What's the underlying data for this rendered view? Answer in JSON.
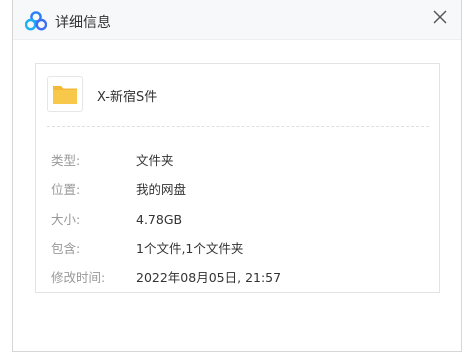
{
  "window": {
    "title": "详细信息"
  },
  "file": {
    "name": "X-新宿S件",
    "icon": "folder-icon",
    "icon_color": "#f7c84a"
  },
  "details": [
    {
      "label": "类型:",
      "value": "文件夹"
    },
    {
      "label": "位置:",
      "value": "我的网盘"
    },
    {
      "label": "大小:",
      "value": "4.78GB"
    },
    {
      "label": "包含:",
      "value": "1个文件,1个文件夹"
    },
    {
      "label": "修改时间:",
      "value": "2022年08月05日, 21:57"
    }
  ],
  "colors": {
    "brand": "#2a7ff5",
    "label": "#999999",
    "text": "#333333"
  }
}
